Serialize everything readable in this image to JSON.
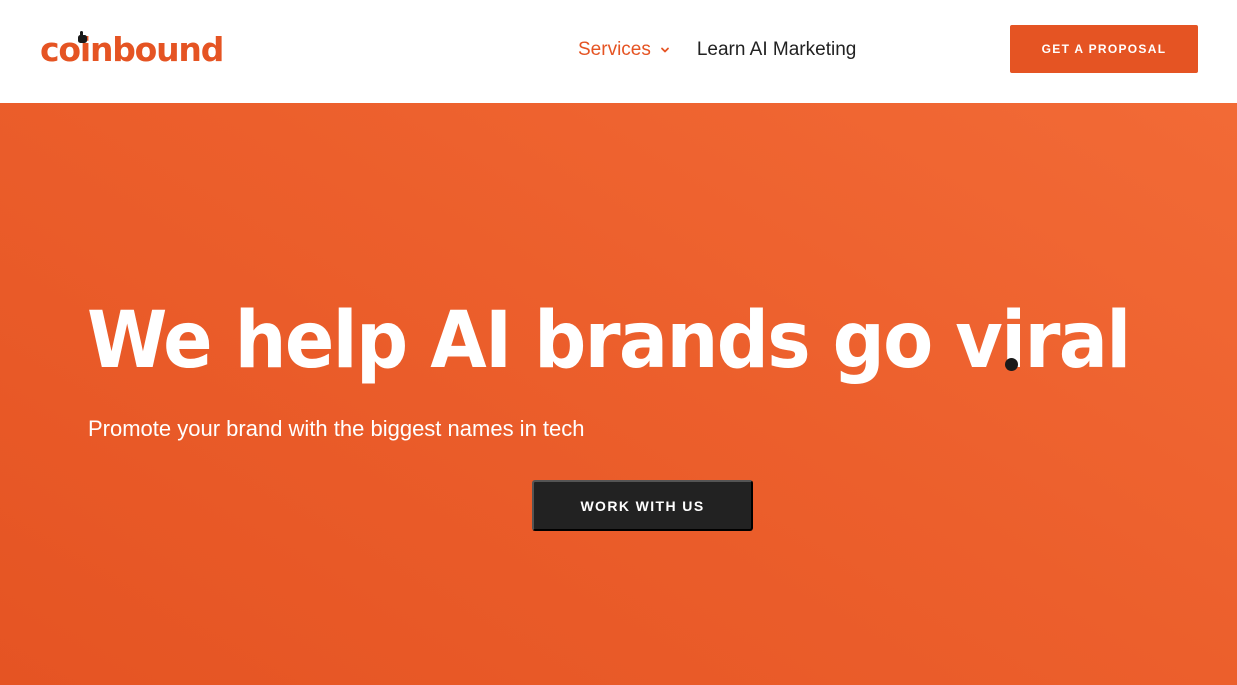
{
  "brand": {
    "name": "coinbound",
    "accent_color": "#e55423",
    "dark_color": "#222222",
    "logo_icon": "fist-icon"
  },
  "nav": {
    "items": [
      {
        "label": "Services",
        "has_dropdown": true,
        "icon": "chevron-down-icon",
        "active": true
      },
      {
        "label": "Learn AI Marketing",
        "has_dropdown": false
      }
    ]
  },
  "header_cta": {
    "label": "GET A PROPOSAL"
  },
  "hero": {
    "headline": "We help AI brands go viral",
    "subheadline": "Promote your brand with the biggest names in tech",
    "cta_label": "WORK WITH US",
    "background_color": "#ec5f2c"
  }
}
